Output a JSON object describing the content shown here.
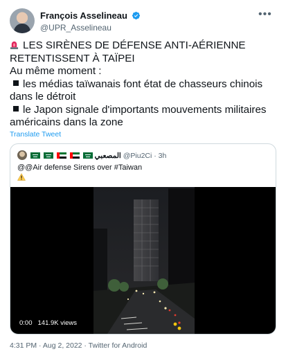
{
  "author": {
    "display_name": "François Asselineau",
    "handle": "@UPR_Asselineau",
    "verified_icon": "verified-badge-icon",
    "more_icon": "more-dots-icon"
  },
  "tweet": {
    "lines": [
      "LES SIRÈNES DE DÉFENSE ANTI-AÉRIENNE",
      "RETENTISSENT À TAÏPEI",
      "Au même moment :",
      "les médias taïwanais font état de chasseurs chinois",
      "dans le détroit",
      "le Japon signale d'importants mouvements militaires",
      "américains dans la zone"
    ],
    "translate_label": "Translate Tweet"
  },
  "quote": {
    "display_name": "المصعبي",
    "handle": "@Piu2Ci",
    "time": "3h",
    "separator": "·",
    "text": "@@Air defense Sirens over #Taiwan",
    "flags": [
      "saudi-flag-icon",
      "saudi-flag-icon",
      "uae-flag-icon",
      "uae-flag-icon",
      "saudi-flag-icon"
    ],
    "video": {
      "time": "0:00",
      "views": "141.9K views"
    }
  },
  "footer": {
    "time": "4:31 PM",
    "date": "Aug 2, 2022",
    "source": "Twitter for Android"
  },
  "colors": {
    "accent": "#1d9bf0",
    "secondary_text": "#536471",
    "border": "#cfd9de",
    "siren_red": "#e0245e"
  }
}
